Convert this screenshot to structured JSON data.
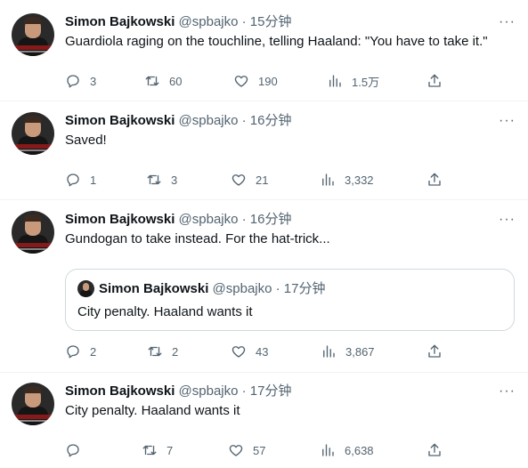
{
  "tweets": [
    {
      "name": "Simon Bajkowski",
      "handle": "@spbajko · 15分钟",
      "text": "Guardiola raging on the touchline, telling Haaland: \"You have to take it.\"",
      "replies": "3",
      "retweets": "60",
      "likes": "190",
      "views": "1.5万"
    },
    {
      "name": "Simon Bajkowski",
      "handle": "@spbajko · 16分钟",
      "text": "Saved!",
      "replies": "1",
      "retweets": "3",
      "likes": "21",
      "views": "3,332"
    },
    {
      "name": "Simon Bajkowski",
      "handle": "@spbajko · 16分钟",
      "text": "Gundogan to take instead. For the hat-trick...",
      "quote": {
        "name": "Simon Bajkowski",
        "handle": "@spbajko · 17分钟",
        "text": "City penalty. Haaland wants it"
      },
      "replies": "2",
      "retweets": "2",
      "likes": "43",
      "views": "3,867"
    },
    {
      "name": "Simon Bajkowski",
      "handle": "@spbajko · 17分钟",
      "text": "City penalty. Haaland wants it",
      "replies": "",
      "retweets": "7",
      "likes": "57",
      "views": "6,638"
    }
  ],
  "more_label": "···",
  "icons": [
    "reply-icon",
    "retweet-icon",
    "like-icon",
    "views-icon",
    "share-icon",
    "more-icon"
  ],
  "colors": {
    "text": "#0f1419",
    "secondary": "#536471",
    "border": "#eff3f4",
    "quote_border": "#cfd9de"
  }
}
